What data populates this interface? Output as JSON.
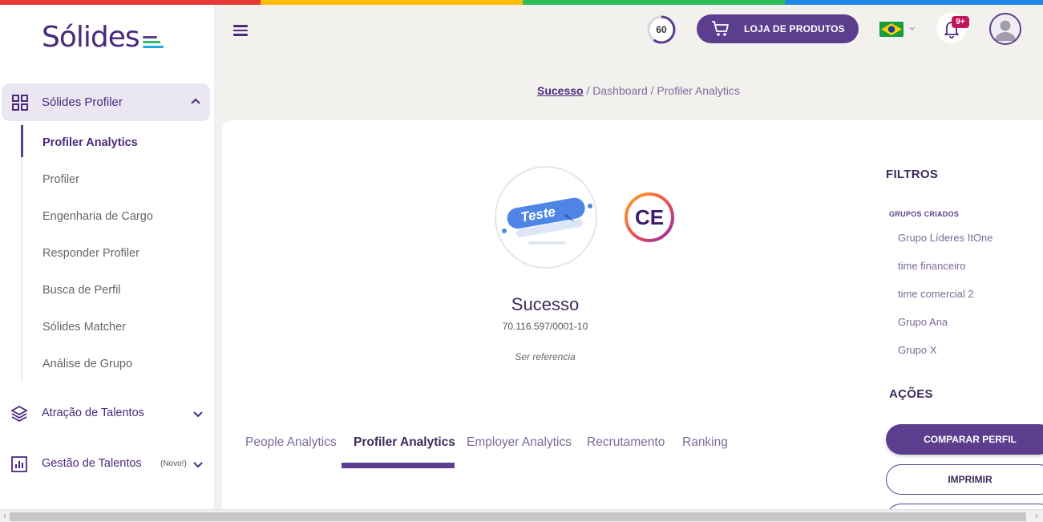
{
  "colors": {
    "primary": "#5b3f8e",
    "brand_text": "#4a2a7c",
    "stripe": [
      "#e53935",
      "#fbbc05",
      "#2ebd59",
      "#1e88e5"
    ]
  },
  "logo": {
    "text": "Sólides"
  },
  "sidebar": {
    "group": {
      "label": "Sólides Profiler",
      "icon": "grid-icon"
    },
    "subitems": [
      {
        "label": "Profiler Analytics",
        "active": true
      },
      {
        "label": "Profiler"
      },
      {
        "label": "Engenharia de Cargo"
      },
      {
        "label": "Responder Profiler"
      },
      {
        "label": "Busca de Perfil"
      },
      {
        "label": "Sólides Matcher"
      },
      {
        "label": "Análise de Grupo"
      }
    ],
    "main_items": [
      {
        "label": "Atração de Talentos",
        "icon": "layers-icon"
      },
      {
        "label": "Gestão de Talentos",
        "icon": "chart-icon",
        "badge": "(Novo!)"
      }
    ]
  },
  "header": {
    "score": "60",
    "score_progress": 0.6,
    "store_label": "LOJA DE PRODUTOS",
    "notifications_badge": "9+",
    "language": "Brazil flag"
  },
  "breadcrumb": {
    "root": "Sucesso",
    "rest": " / Dashboard / Profiler Analytics"
  },
  "company": {
    "logo_text": "Teste",
    "badge": "CE",
    "name": "Sucesso",
    "cnpj": "70.116.597/0001-10",
    "reference": "Ser referencia"
  },
  "tabs": [
    {
      "label": "People Analytics"
    },
    {
      "label": "Profiler Analytics",
      "active": true
    },
    {
      "label": "Employer Analytics"
    },
    {
      "label": "Recrutamento"
    },
    {
      "label": "Ranking"
    }
  ],
  "filters": {
    "title": "FILTROS",
    "groups_title": "GRUPOS CRIADOS",
    "groups": [
      "Grupo Líderes ItOne",
      "time financeiro",
      "time comercial 2",
      "Grupo Ana",
      "Grupo X"
    ]
  },
  "actions": {
    "title": "AÇÕES",
    "compare_label": "COMPARAR PERFIL",
    "print_label": "IMPRIMIR"
  }
}
